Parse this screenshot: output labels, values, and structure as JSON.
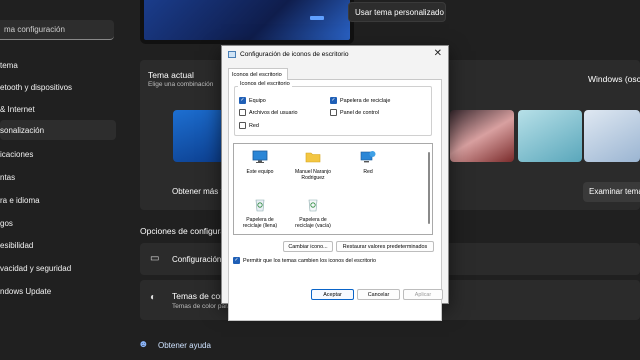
{
  "search": {
    "value": "ma configuración"
  },
  "sidebar": {
    "items": [
      {
        "label": "tema"
      },
      {
        "label": "etooth y dispositivos"
      },
      {
        "label": "& Internet"
      },
      {
        "label": "sonalización"
      },
      {
        "label": "icaciones"
      },
      {
        "label": "ntas"
      },
      {
        "label": "ra e idioma"
      },
      {
        "label": "gos"
      },
      {
        "label": "esibilidad"
      },
      {
        "label": "vacidad y seguridad"
      },
      {
        "label": "ndows Update"
      }
    ]
  },
  "main": {
    "custom_theme_button": "Usar tema personalizado",
    "current_theme_title": "Tema actual",
    "current_theme_sub": "Elige una combinación",
    "theme_name": "Windows (oscu",
    "get_more": "Obtener más t",
    "explore_button": "Examinar tema",
    "related_options": "Opciones de configura",
    "config_row": "Configuración",
    "contrast_title": "Temas de cor",
    "contrast_sub": "Temas de color para deficiencias visuales, sensibilidad a la luz",
    "help_link": "Obtener ayuda"
  },
  "dialog": {
    "title": "Configuración de iconos de escritorio",
    "tab": "Iconos del escritorio",
    "group_label": "Iconos del escritorio",
    "checkboxes": [
      {
        "label": "Equipo",
        "checked": true
      },
      {
        "label": "Papelera de reciclaje",
        "checked": true
      },
      {
        "label": "Archivos del usuario",
        "checked": false
      },
      {
        "label": "Panel de control",
        "checked": false
      },
      {
        "label": "Red",
        "checked": false
      }
    ],
    "icons": [
      {
        "label": "Este equipo",
        "icon": "monitor-icon"
      },
      {
        "label": "Manuel Naranjo Rodriguez",
        "icon": "folder-icon"
      },
      {
        "label": "Red",
        "icon": "network-icon"
      },
      {
        "label": "Papelera de reciclaje (llena)",
        "icon": "recycle-bin-full-icon"
      },
      {
        "label": "Papelera de reciclaje (vacía)",
        "icon": "recycle-bin-empty-icon"
      }
    ],
    "change_icon": "Cambiar icono...",
    "restore_defaults": "Restaurar valores predeterminados",
    "allow_themes": "Permitir que los temas cambien los iconos del escritorio",
    "allow_themes_checked": true,
    "ok": "Aceptar",
    "cancel": "Cancelar",
    "apply": "Aplicar"
  }
}
